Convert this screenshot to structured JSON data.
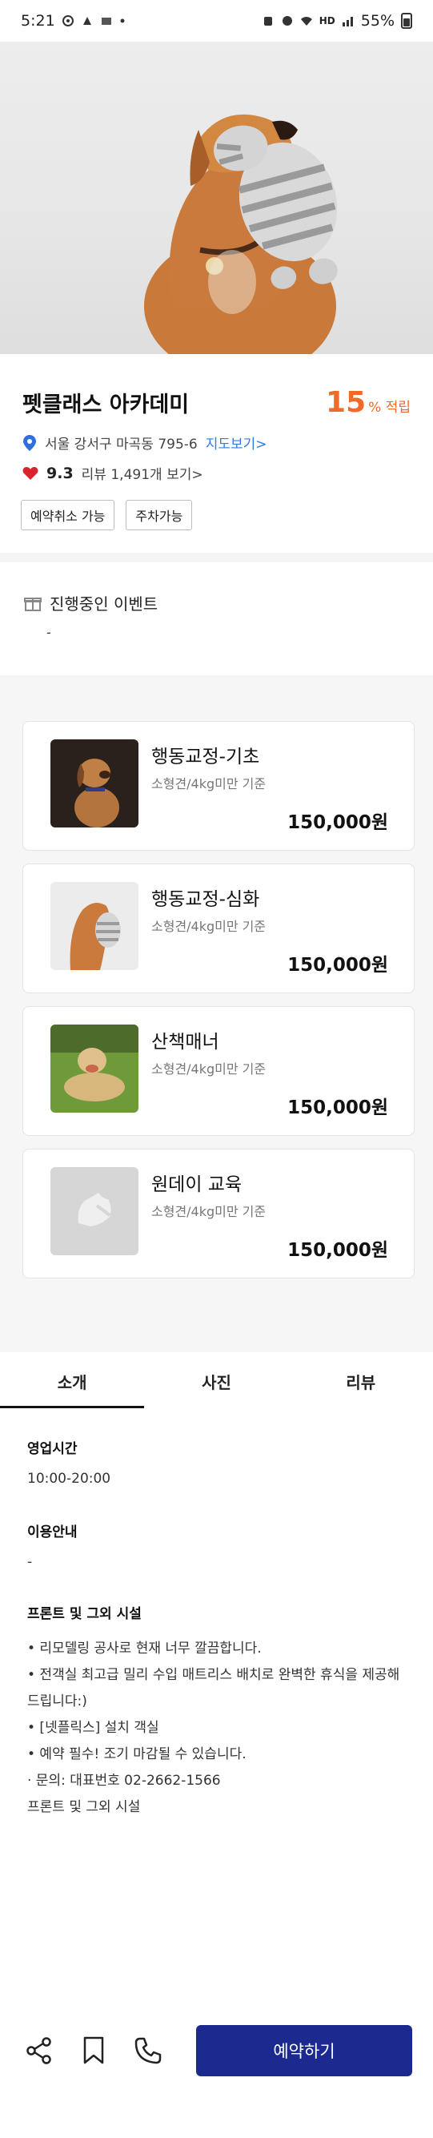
{
  "status_bar": {
    "time": "5:21",
    "network": "HD",
    "battery": "55%"
  },
  "place": {
    "title": "펫클래스 아카데미",
    "point_value": "15",
    "point_unit": "% 적립",
    "address": "서울 강서구 마곡동 795-6",
    "map_link": "지도보기>",
    "rating": "9.3",
    "reviews": "리뷰 1,491개 보기>",
    "tags": [
      "예약취소 가능",
      "주차가능"
    ]
  },
  "event": {
    "title": "진행중인 이벤트",
    "value": "-"
  },
  "products": [
    {
      "name": "행동교정-기초",
      "desc": "소형견/4kg미만 기준",
      "price": "150,000원"
    },
    {
      "name": "행동교정-심화",
      "desc": "소형견/4kg미만 기준",
      "price": "150,000원"
    },
    {
      "name": "산책매너",
      "desc": "소형견/4kg미만 기준",
      "price": "150,000원"
    },
    {
      "name": "원데이 교육",
      "desc": "소형견/4kg미만 기준",
      "price": "150,000원"
    }
  ],
  "tabs": [
    {
      "label": "소개",
      "active": true
    },
    {
      "label": "사진",
      "active": false
    },
    {
      "label": "리뷰",
      "active": false
    }
  ],
  "info": {
    "hours_title": "영업시간",
    "hours": "10:00-20:00",
    "usage_title": "이용안내",
    "usage": "-",
    "facility_title": "프론트 및 그외 시설",
    "facility_lines": [
      "• 리모델링 공사로 현재 너무 깔끔합니다.",
      "• 전객실 최고급 밀리 수입 매트리스 배치로 완벽한 휴식을 제공해드립니다:)",
      "• [넷플릭스] 설치 객실",
      "• 예약 필수! 조기 마감될 수 있습니다.",
      "· 문의: 대표번호 02-2662-1566",
      "프론트 및 그외 시설"
    ]
  },
  "bottom": {
    "reserve_label": "예약하기"
  },
  "colors": {
    "accent": "#f06a2a",
    "link": "#2f7be0",
    "primary": "#1c2a8f",
    "heart": "#d9232d"
  }
}
